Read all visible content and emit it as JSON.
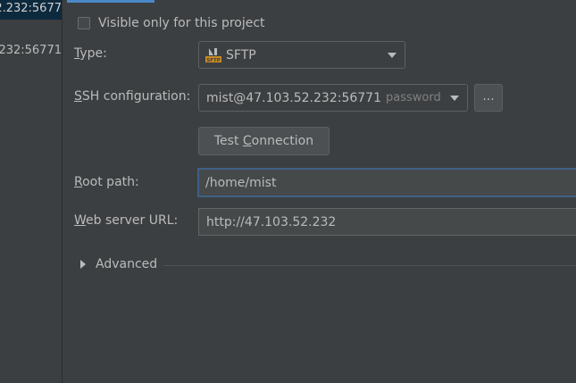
{
  "server_list": {
    "selected_item": "2.232:5677",
    "other_item": ".232:56771"
  },
  "visible_only": {
    "label": "Visible only for this project",
    "checked": false
  },
  "type": {
    "label_mnemonic": "T",
    "label_rest": "ype:",
    "value": "SFTP",
    "icon": "sftp-icon"
  },
  "ssh": {
    "label_mnemonic": "S",
    "label_rest": "SH configuration:",
    "value": "mist@47.103.52.232:56771",
    "auth_hint": "password",
    "browse_label": "..."
  },
  "test_connection": {
    "label_pre": "Test ",
    "label_mnemonic": "C",
    "label_post": "onnection"
  },
  "root_path": {
    "label_mnemonic": "R",
    "label_rest": "oot path:",
    "value": "/home/mist"
  },
  "web_url": {
    "label_mnemonic": "W",
    "label_rest": "eb server URL:",
    "value": "http://47.103.52.232"
  },
  "advanced": {
    "label": "Advanced"
  },
  "colors": {
    "background": "#3c3f41",
    "selection": "#0d293e",
    "focus_border": "#3d6185",
    "accent": "#4a88c7",
    "sftp_icon": "#c78a26"
  }
}
